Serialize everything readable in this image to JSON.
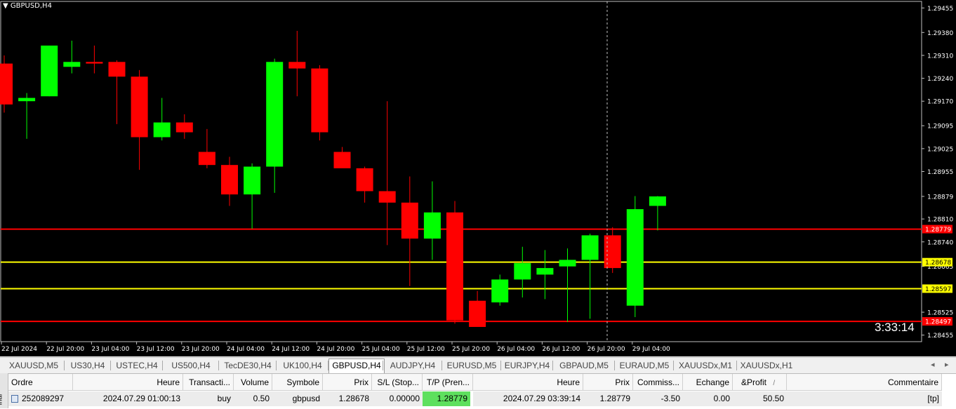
{
  "chart": {
    "symbol_title": "GBPUSD,H4",
    "countdown": "3:33:14",
    "colors": {
      "background": "#000000",
      "bull": "#00ff00",
      "bear": "#ff0000",
      "axis_text": "#ffffff"
    },
    "price_labels": [
      "1.29455",
      "1.29380",
      "1.29310",
      "1.29240",
      "1.29170",
      "1.29095",
      "1.29025",
      "1.28955",
      "1.28879",
      "1.28810",
      "1.28740",
      "1.28665",
      "1.28525",
      "1.28455"
    ],
    "levels": [
      {
        "price": "1.28779",
        "color": "#ff0000"
      },
      {
        "price": "1.28678",
        "color": "#ffff00"
      },
      {
        "price": "1.28597",
        "color": "#ffff00"
      },
      {
        "price": "1.28497",
        "color": "#ff0000"
      }
    ],
    "time_labels": [
      "22 Jul 2024",
      "22 Jul 20:00",
      "23 Jul 04:00",
      "23 Jul 12:00",
      "23 Jul 20:00",
      "24 Jul 04:00",
      "24 Jul 12:00",
      "24 Jul 20:00",
      "25 Jul 04:00",
      "25 Jul 12:00",
      "25 Jul 20:00",
      "26 Jul 04:00",
      "26 Jul 12:00",
      "26 Jul 20:00",
      "29 Jul 04:00"
    ]
  },
  "chart_data": {
    "type": "candlestick",
    "symbol": "GBPUSD",
    "timeframe": "H4",
    "candles": [
      {
        "o": 1.29285,
        "h": 1.2931,
        "l": 1.29135,
        "c": 1.2916
      },
      {
        "o": 1.2917,
        "h": 1.29195,
        "l": 1.29055,
        "c": 1.2918
      },
      {
        "o": 1.29185,
        "h": 1.2934,
        "l": 1.29185,
        "c": 1.2934
      },
      {
        "o": 1.29275,
        "h": 1.29355,
        "l": 1.29255,
        "c": 1.2929
      },
      {
        "o": 1.2929,
        "h": 1.2934,
        "l": 1.29255,
        "c": 1.29285
      },
      {
        "o": 1.2929,
        "h": 1.29295,
        "l": 1.291,
        "c": 1.29245
      },
      {
        "o": 1.29245,
        "h": 1.29265,
        "l": 1.2896,
        "c": 1.2906
      },
      {
        "o": 1.2906,
        "h": 1.2918,
        "l": 1.2905,
        "c": 1.29105
      },
      {
        "o": 1.29105,
        "h": 1.2913,
        "l": 1.29055,
        "c": 1.29075
      },
      {
        "o": 1.29015,
        "h": 1.29085,
        "l": 1.28965,
        "c": 1.28975
      },
      {
        "o": 1.28975,
        "h": 1.29,
        "l": 1.2885,
        "c": 1.28885
      },
      {
        "o": 1.28885,
        "h": 1.2898,
        "l": 1.2878,
        "c": 1.2897
      },
      {
        "o": 1.2897,
        "h": 1.293,
        "l": 1.2889,
        "c": 1.2929
      },
      {
        "o": 1.2929,
        "h": 1.29385,
        "l": 1.29185,
        "c": 1.2927
      },
      {
        "o": 1.2927,
        "h": 1.2928,
        "l": 1.2905,
        "c": 1.29075
      },
      {
        "o": 1.29015,
        "h": 1.2903,
        "l": 1.2897,
        "c": 1.28965
      },
      {
        "o": 1.28965,
        "h": 1.2897,
        "l": 1.2886,
        "c": 1.28895
      },
      {
        "o": 1.28895,
        "h": 1.2917,
        "l": 1.2873,
        "c": 1.2886
      },
      {
        "o": 1.2886,
        "h": 1.2894,
        "l": 1.28605,
        "c": 1.2875
      },
      {
        "o": 1.2875,
        "h": 1.28925,
        "l": 1.28685,
        "c": 1.2883
      },
      {
        "o": 1.2883,
        "h": 1.28865,
        "l": 1.2849,
        "c": 1.285
      },
      {
        "o": 1.2856,
        "h": 1.2859,
        "l": 1.2848,
        "c": 1.2848
      },
      {
        "o": 1.28555,
        "h": 1.2864,
        "l": 1.28545,
        "c": 1.28625
      },
      {
        "o": 1.28625,
        "h": 1.28725,
        "l": 1.2857,
        "c": 1.28675
      },
      {
        "o": 1.2864,
        "h": 1.28715,
        "l": 1.28565,
        "c": 1.2866
      },
      {
        "o": 1.28665,
        "h": 1.2872,
        "l": 1.28495,
        "c": 1.28685
      },
      {
        "o": 1.28685,
        "h": 1.28765,
        "l": 1.28505,
        "c": 1.2876
      },
      {
        "o": 1.2876,
        "h": 1.28785,
        "l": 1.28645,
        "c": 1.2866
      },
      {
        "o": 1.28545,
        "h": 1.2888,
        "l": 1.2851,
        "c": 1.2884
      },
      {
        "o": 1.2885,
        "h": 1.2888,
        "l": 1.28775,
        "c": 1.28879
      }
    ],
    "y_range": [
      1.28435,
      1.29475
    ]
  },
  "tabs": {
    "items": [
      "XAUUSD,M5",
      "US30,H4",
      "USTEC,H4",
      "US500,H4",
      "TecDE30,H4",
      "UK100,H4",
      "GBPUSD,H4",
      "AUDJPY,H4",
      "EURUSD,M5",
      "EURJPY,H4",
      "GBPAUD,M5",
      "EURAUD,M5",
      "XAUUSDx,M1",
      "XAUUSDx,H1"
    ],
    "active": "GBPUSD,H4"
  },
  "terminal": {
    "side_label": "inal",
    "headers": [
      "Ordre",
      "Heure",
      "Transacti...",
      "Volume",
      "Symbole",
      "Prix",
      "S/L (Stop...",
      "T/P (Pren...",
      "Heure",
      "Prix",
      "Commiss...",
      "Echange",
      "&Profit",
      "Commentaire"
    ],
    "sort_mark": "/",
    "row": {
      "order": "252089297",
      "open_time": "2024.07.29 01:00:13",
      "type": "buy",
      "volume": "0.50",
      "symbol": "gbpusd",
      "price": "1.28678",
      "sl": "0.00000",
      "tp": "1.28779",
      "close_time": "2024.07.29 03:39:14",
      "close_price": "1.28779",
      "commission": "-3.50",
      "swap": "0.00",
      "profit": "50.50",
      "comment": "[tp]"
    }
  }
}
